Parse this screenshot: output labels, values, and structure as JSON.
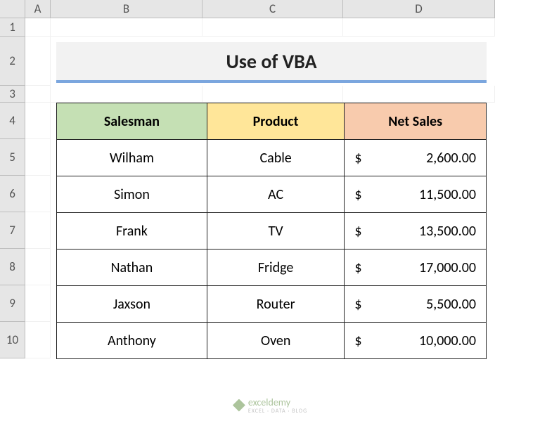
{
  "columns": [
    "A",
    "B",
    "C",
    "D"
  ],
  "rows": [
    "1",
    "2",
    "3",
    "4",
    "5",
    "6",
    "7",
    "8",
    "9",
    "10"
  ],
  "title": "Use of VBA",
  "headers": {
    "salesman": "Salesman",
    "product": "Product",
    "netsales": "Net Sales"
  },
  "data": [
    {
      "salesman": "Wilham",
      "product": "Cable",
      "currency": "$",
      "netsales": "2,600.00"
    },
    {
      "salesman": "Simon",
      "product": "AC",
      "currency": "$",
      "netsales": "11,500.00"
    },
    {
      "salesman": "Frank",
      "product": "TV",
      "currency": "$",
      "netsales": "13,500.00"
    },
    {
      "salesman": "Nathan",
      "product": "Fridge",
      "currency": "$",
      "netsales": "17,000.00"
    },
    {
      "salesman": "Jaxson",
      "product": "Router",
      "currency": "$",
      "netsales": "5,500.00"
    },
    {
      "salesman": "Anthony",
      "product": "Oven",
      "currency": "$",
      "netsales": "10,000.00"
    }
  ],
  "watermark": {
    "brand": "exceldemy",
    "tagline": "EXCEL · DATA · BLOG"
  },
  "chart_data": {
    "type": "table",
    "title": "Use of VBA",
    "columns": [
      "Salesman",
      "Product",
      "Net Sales"
    ],
    "rows": [
      [
        "Wilham",
        "Cable",
        2600.0
      ],
      [
        "Simon",
        "AC",
        11500.0
      ],
      [
        "Frank",
        "TV",
        13500.0
      ],
      [
        "Nathan",
        "Fridge",
        17000.0
      ],
      [
        "Jaxson",
        "Router",
        5500.0
      ],
      [
        "Anthony",
        "Oven",
        10000.0
      ]
    ]
  }
}
